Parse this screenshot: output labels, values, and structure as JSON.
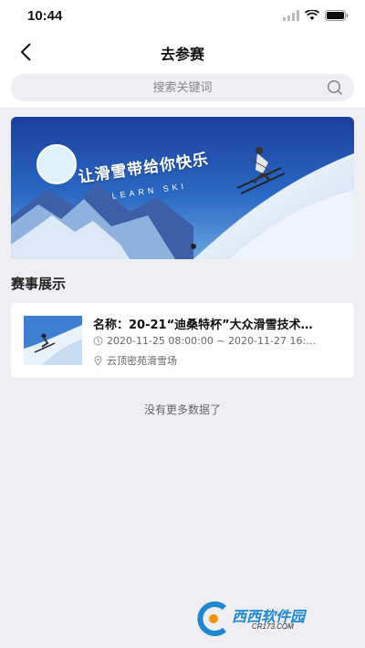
{
  "status_bar": {
    "time": "10:44"
  },
  "nav": {
    "title": "去参赛"
  },
  "search": {
    "placeholder": "搜索关键词"
  },
  "banner": {
    "slogan": "让滑雪带给你快乐",
    "subtitle": "LEARN SKI"
  },
  "section": {
    "title": "赛事展示"
  },
  "events": [
    {
      "name": "名称：20-21“迪桑特杯”大众滑雪技术…",
      "time": "2020-11-25 08:00:00 ~ 2020-11-27 16:…",
      "location": "云顶密苑滑雪场"
    }
  ],
  "list_footer": "没有更多数据了",
  "watermark": {
    "brand": "西西软件园",
    "site": "CR173.COM"
  },
  "colors": {
    "accent_blue": "#1f88d3",
    "background": "#efeff3"
  }
}
